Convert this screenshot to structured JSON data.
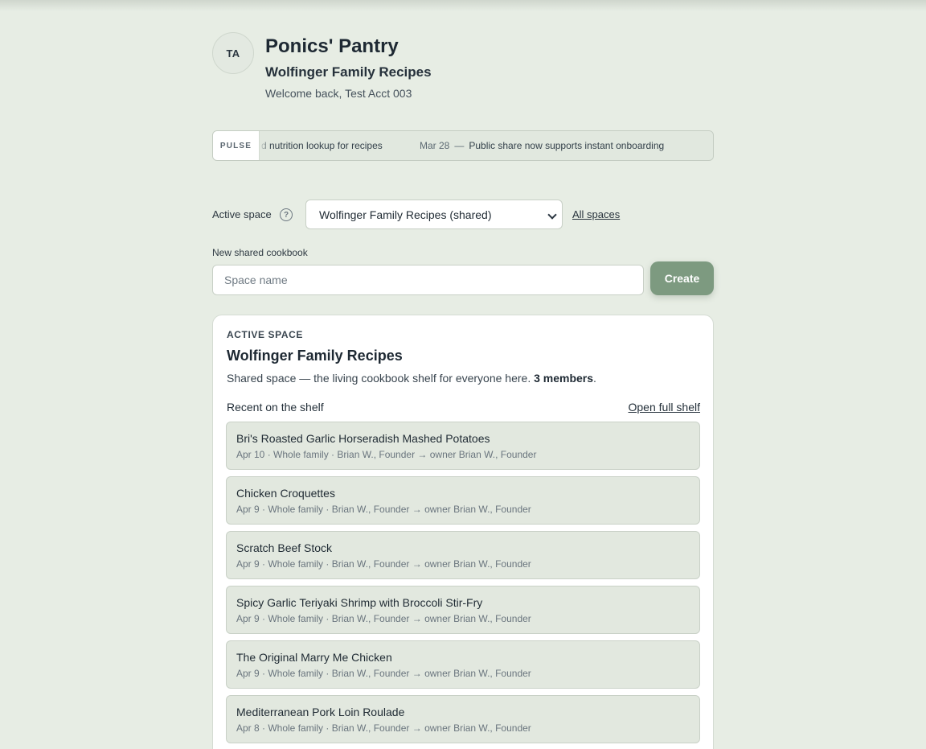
{
  "header": {
    "avatar_initials": "TA",
    "app_title": "Ponics' Pantry",
    "space_title": "Wolfinger Family Recipes",
    "welcome": "Welcome back, Test Acct 003"
  },
  "pulse": {
    "label": "PULSE",
    "items": [
      {
        "date": "",
        "text": "d nutrition lookup for recipes"
      },
      {
        "date": "Mar 28",
        "dash": "—",
        "text": "Public share now supports instant onboarding"
      }
    ]
  },
  "space_selector": {
    "label": "Active space",
    "help_icon": "question-circle-icon",
    "selected": "Wolfinger Family Recipes (shared)",
    "all_spaces_link": "All spaces"
  },
  "new_cookbook": {
    "label": "New shared cookbook",
    "placeholder": "Space name",
    "value": "",
    "create_label": "Create"
  },
  "active_card": {
    "eyebrow": "ACTIVE SPACE",
    "title": "Wolfinger Family Recipes",
    "description": "Shared space — the living cookbook shelf for everyone here.",
    "members": "3 members",
    "recent_label": "Recent on the shelf",
    "open_full_shelf": "Open full shelf",
    "recipes": [
      {
        "title": "Bri's Roasted Garlic Horseradish Mashed Potatoes",
        "meta": "Apr 10 · Whole family · Brian W., Founder → owner Brian W., Founder"
      },
      {
        "title": "Chicken Croquettes",
        "meta": "Apr 9 · Whole family · Brian W., Founder → owner Brian W., Founder"
      },
      {
        "title": "Scratch Beef Stock",
        "meta": "Apr 9 · Whole family · Brian W., Founder → owner Brian W., Founder"
      },
      {
        "title": "Spicy Garlic Teriyaki Shrimp with Broccoli Stir-Fry",
        "meta": "Apr 9 · Whole family · Brian W., Founder → owner Brian W., Founder"
      },
      {
        "title": "The Original Marry Me Chicken",
        "meta": "Apr 9 · Whole family · Brian W., Founder → owner Brian W., Founder"
      },
      {
        "title": "Mediterranean Pork Loin Roulade",
        "meta": "Apr 8 · Whole family · Brian W., Founder → owner Brian W., Founder"
      }
    ]
  },
  "colors": {
    "background": "#e7ede4",
    "accent_button": "#7d9a80",
    "recipe_row": "#e2e8df"
  }
}
